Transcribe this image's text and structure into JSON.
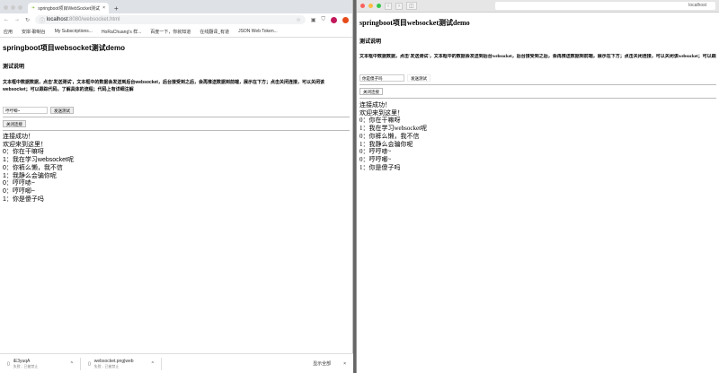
{
  "chrome": {
    "tab_title": "springboot项目WebSocket测试",
    "url_host": "localhost",
    "url_path": ":8080/websocket.html",
    "bookmarks": [
      "应用",
      "安岸-聊制台",
      "My Subscriptions...",
      "HoRaChuang's 样...",
      "百度一下，你就知道",
      "在线翻译_有道",
      "JSON Web Token..."
    ]
  },
  "safari": {
    "url": "localhost"
  },
  "page": {
    "title": "springboot项目websocket测试demo",
    "subtitle": "测试说明",
    "description": "文本框中数据数据，点击'发送测试'，文本框中的数据会发送到后台websocket，后台接受到之后，会再推送数据到前端，展示在下方；点击关闭连接，可以关闭该websocket；可以跟踪代码，了解具体的流程；代码上有详细注解",
    "send_label": "发送测试",
    "close_label": "关闭连接"
  },
  "left": {
    "input_value": "哼哼唧~",
    "messages": [
      "连接成功！",
      "欢迎来到这里！",
      "0：你在干嘛呀",
      "1：我在学习websocket呢",
      "0：你裤么懒，我不信",
      "1：我静么会骗你呢",
      "0：哼哼哧~",
      "0：哼哼唧~",
      "1：你是傻子吗"
    ]
  },
  "right": {
    "input_value": "你是傻子吗",
    "messages": [
      "连接成功！",
      "欢迎来到这里！",
      "0：你在干嘛呀",
      "1：我在学习websocket呢",
      "0：你裤么懒，我不信",
      "1：我静么会骗你呢",
      "0：哼哼哧~",
      "0：哼哼唧~",
      "1：你是傻子吗"
    ]
  },
  "downloads": {
    "items": [
      {
        "name": "iE3yuqA",
        "status": "失败 - 已被禁止"
      },
      {
        "name": "websocket.png|web",
        "status": "失败 - 已被禁止"
      }
    ],
    "show_all": "显示全部"
  }
}
